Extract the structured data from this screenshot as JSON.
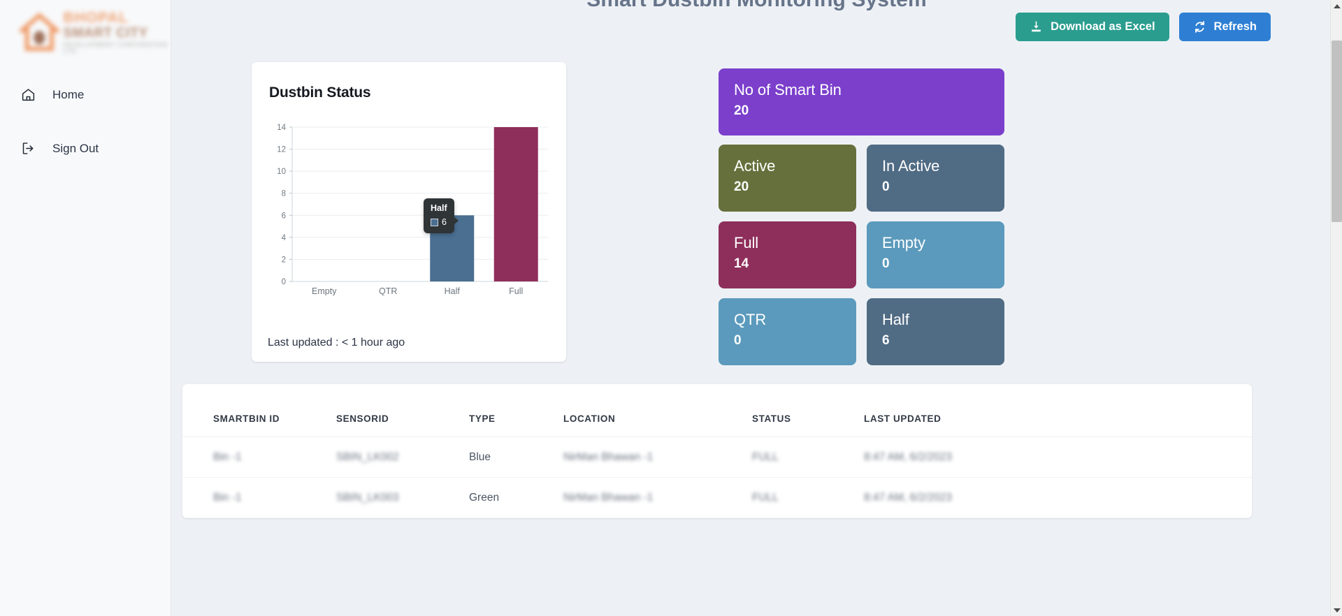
{
  "header": {
    "title": "Smart Dustbin Monitoring System",
    "download_label": "Download as Excel",
    "refresh_label": "Refresh"
  },
  "sidebar": {
    "logo": {
      "line1": "BHOPAL",
      "line2": "SMART CITY",
      "line3": "DEVELOPMENT CORPORATION LTD."
    },
    "items": [
      {
        "label": "Home",
        "icon": "home-icon"
      },
      {
        "label": "Sign Out",
        "icon": "sign-out-icon"
      }
    ]
  },
  "chart_card": {
    "title": "Dustbin Status",
    "last_updated": "Last updated : < 1 hour ago",
    "tooltip": {
      "title": "Half",
      "value": "6"
    }
  },
  "chart_data": {
    "type": "bar",
    "title": "Dustbin Status",
    "categories": [
      "Empty",
      "QTR",
      "Half",
      "Full"
    ],
    "values": [
      0,
      0,
      6,
      14
    ],
    "colors": [
      "#5b9abc",
      "#5b9abc",
      "#4a6f91",
      "#8e2f5b"
    ],
    "xlabel": "",
    "ylabel": "",
    "ylim": [
      0,
      14
    ],
    "yticks": [
      0,
      2,
      4,
      6,
      8,
      10,
      12,
      14
    ],
    "grid": true,
    "legend": false,
    "annotations": [
      {
        "label": "Half",
        "value": 6
      }
    ]
  },
  "stats": {
    "total": {
      "label": "No of Smart Bin",
      "value": "20",
      "color": "#7b3fcc"
    },
    "cells": [
      {
        "label": "Active",
        "value": "20",
        "color": "#66703c"
      },
      {
        "label": "In Active",
        "value": "0",
        "color": "#506b84"
      },
      {
        "label": "Full",
        "value": "14",
        "color": "#8e2f5b"
      },
      {
        "label": "Empty",
        "value": "0",
        "color": "#5b9abc"
      },
      {
        "label": "QTR",
        "value": "0",
        "color": "#5b9abc"
      },
      {
        "label": "Half",
        "value": "6",
        "color": "#506b84"
      }
    ]
  },
  "table": {
    "columns": [
      "SMARTBIN ID",
      "SENSORID",
      "TYPE",
      "LOCATION",
      "STATUS",
      "LAST UPDATED"
    ],
    "rows": [
      {
        "smartbin_id": "Bin -1",
        "sensorid": "SBIN_LK002",
        "type": "Blue",
        "location": "NirMan Bhawan -1",
        "status": "FULL",
        "last_updated": "8:47 AM, 6/2/2023"
      },
      {
        "smartbin_id": "Bin -1",
        "sensorid": "SBIN_LK003",
        "type": "Green",
        "location": "NirMan Bhawan -1",
        "status": "FULL",
        "last_updated": "8:47 AM, 6/2/2023"
      }
    ]
  }
}
